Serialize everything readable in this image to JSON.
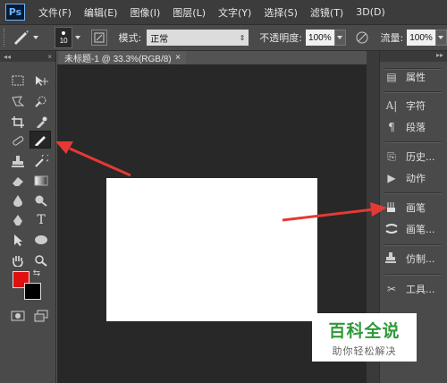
{
  "app": {
    "logo": "Ps"
  },
  "menu": [
    "文件(F)",
    "编辑(E)",
    "图像(I)",
    "图层(L)",
    "文字(Y)",
    "选择(S)",
    "滤镜(T)",
    "3D(D)"
  ],
  "options": {
    "brush_size": "10",
    "mode_label": "模式:",
    "mode_value": "正常",
    "opacity_label": "不透明度:",
    "opacity_value": "100%",
    "flow_label": "流量:",
    "flow_value": "100%"
  },
  "document": {
    "tab_title": "未标题-1 @ 33.3%(RGB/8)",
    "close": "×"
  },
  "toolbox": {
    "collapse": "◂◂",
    "close": "×",
    "fg_color": "#e01010",
    "bg_color": "#000000"
  },
  "dock": {
    "collapse": "▸▸",
    "panels": [
      {
        "icon": "properties-icon",
        "label": "属性"
      },
      {
        "icon": "character-icon",
        "label": "字符"
      },
      {
        "icon": "paragraph-icon",
        "label": "段落"
      },
      {
        "icon": "history-icon",
        "label": "历史..."
      },
      {
        "icon": "actions-icon",
        "label": "动作"
      },
      {
        "icon": "brush-panel-icon",
        "label": "画笔"
      },
      {
        "icon": "brush-presets-icon",
        "label": "画笔..."
      },
      {
        "icon": "clone-source-icon",
        "label": "仿制..."
      },
      {
        "icon": "tool-presets-icon",
        "label": "工具..."
      }
    ]
  },
  "watermark": {
    "main": "百科全说",
    "sub": "助你轻松解决"
  },
  "colors": {
    "accent_arrow": "#e53935",
    "canvas": "#ffffff",
    "workspace": "#282828"
  }
}
